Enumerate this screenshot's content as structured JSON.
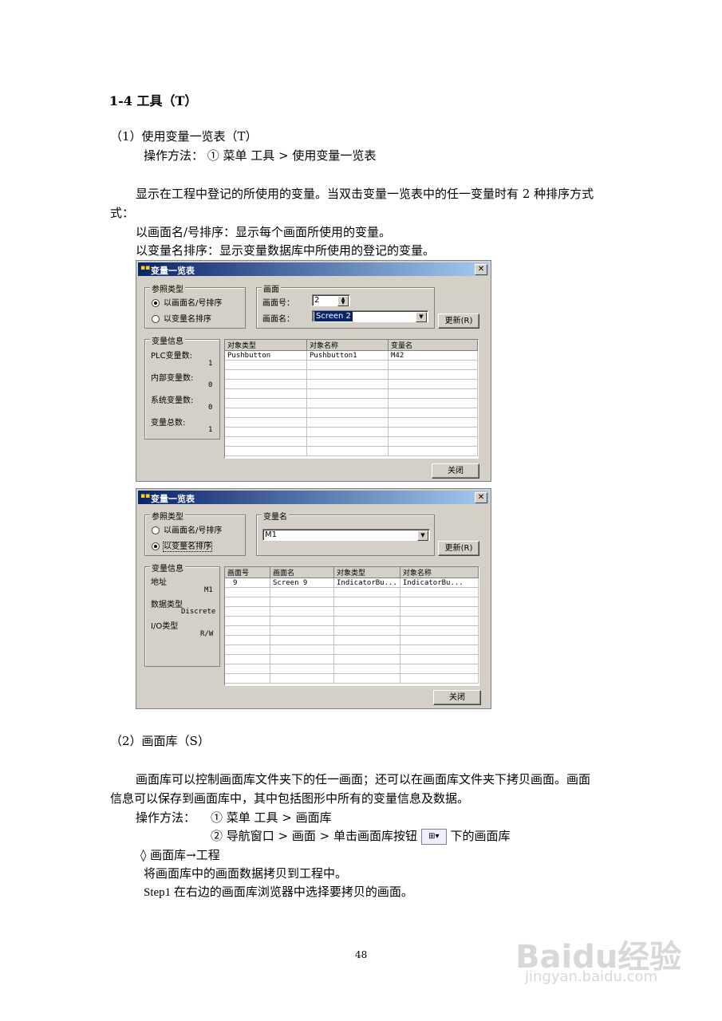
{
  "heading": "1-4  工具（T）",
  "s1": {
    "title": "（1）使用变量一览表（T）",
    "method": "操作方法：  ①  菜单  工具 > 使用变量一览表",
    "desc1": "显示在工程中登记的所使用的变量。当双击变量一览表中的任一变量时有 2 种排序方式",
    "desc1b": "式：",
    "desc2": "以画面名/号排序：显示每个画面所使用的变量。",
    "desc3": "以变量名排序：显示变量数据库中所使用的登记的变量。"
  },
  "dialog1": {
    "title": "变量一览表",
    "ref_group": "参照类型",
    "radio1": "以画面名/号排序",
    "radio2": "以变量名排序",
    "screen_group": "画面",
    "screen_no_label": "画面号：",
    "screen_no_value": "2",
    "screen_name_label": "画面名：",
    "screen_name_value": "Screen 2",
    "update_btn": "更新(R)",
    "info_group": "变量信息",
    "plc_label": "PLC变量数:",
    "plc_value": "1",
    "internal_label": "内部变量数:",
    "internal_value": "0",
    "system_label": "系统变量数:",
    "system_value": "0",
    "total_label": "变量总数:",
    "total_value": "1",
    "columns": [
      "对象类型",
      "对象名称",
      "变量名"
    ],
    "rows": [
      [
        "Pushbutton",
        "Pushbutton1",
        "M42"
      ]
    ],
    "close_btn": "关闭"
  },
  "dialog2": {
    "title": "变量一览表",
    "ref_group": "参照类型",
    "radio1": "以画面名/号排序",
    "radio2": "以变量名排序",
    "var_group": "变量名",
    "var_value": "M1",
    "update_btn": "更新(R)",
    "info_group": "变量信息",
    "addr_label": "地址",
    "addr_value": "M1",
    "type_label": "数据类型",
    "type_value": "Discrete",
    "io_label": "I/O类型",
    "io_value": "R/W",
    "columns": [
      "画面号",
      "画面名",
      "对象类型",
      "对象名称"
    ],
    "rows": [
      [
        "9",
        "Screen 9",
        "IndicatorBu...",
        "IndicatorBu..."
      ]
    ],
    "close_btn": "关闭"
  },
  "s2": {
    "title": "（2）画面库（S）",
    "desc1": "画面库可以控制画面库文件夹下的任一画面；还可以在画面库文件夹下拷贝画面。画面",
    "desc2": "信息可以保存到画面库中，其中包括图形中所有的变量信息及数据。",
    "method_label": "操作方法：",
    "method1": "①  菜单  工具 > 画面库",
    "method2a": "②  导航窗口 > 画面 > 单击画面库按钮",
    "method2b": "下的画面库",
    "bullet": "◊      画面库→工程",
    "copy": "将画面库中的画面数据拷贝到工程中。",
    "step1": "Step1    在右边的画面库浏览器中选择要拷贝的画面。"
  },
  "page_number": "48",
  "watermark": {
    "logo": "Baidu经验",
    "url": "jingyan.baidu.com"
  }
}
